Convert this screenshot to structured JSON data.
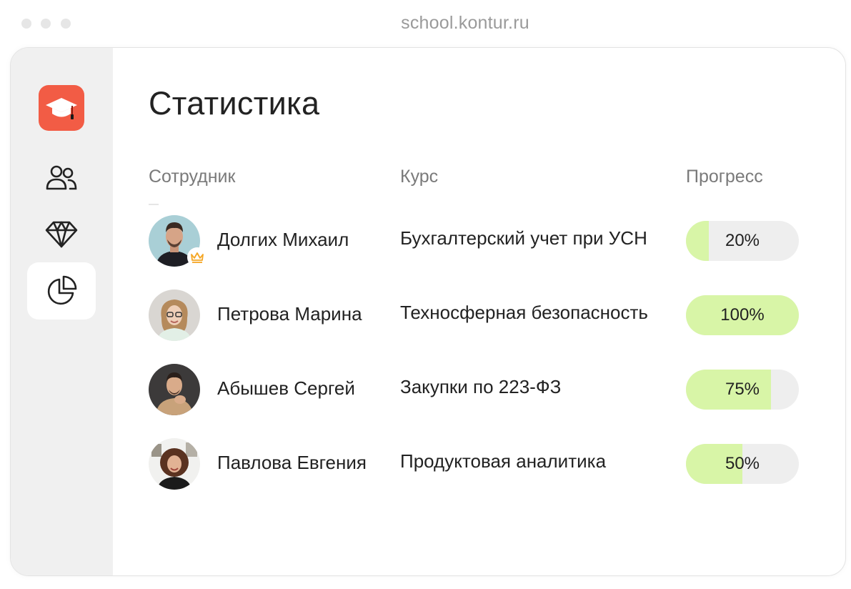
{
  "browser": {
    "url": "school.kontur.ru"
  },
  "sidebar": {
    "logo_icon": "graduation-cap-icon",
    "items": [
      {
        "icon": "users-icon",
        "active": false
      },
      {
        "icon": "diamond-icon",
        "active": false
      },
      {
        "icon": "pie-chart-icon",
        "active": true
      }
    ]
  },
  "page": {
    "title": "Статистика"
  },
  "table": {
    "headers": {
      "employee": "Сотрудник",
      "course": "Курс",
      "progress": "Прогресс"
    },
    "rows": [
      {
        "name": "Долгих Михаил",
        "course": "Бухгалтерский учет при УСН",
        "progress_label": "20%",
        "progress": 20,
        "admin_badge": "crown-icon"
      },
      {
        "name": "Петрова Марина",
        "course": "Техносферная безопасность",
        "progress_label": "100%",
        "progress": 100
      },
      {
        "name": "Абышев Сергей",
        "course": "Закупки по 223-ФЗ",
        "progress_label": "75%",
        "progress": 75
      },
      {
        "name": "Павлова Евгения",
        "course": "Продуктовая аналитика",
        "progress_label": "50%",
        "progress": 50
      }
    ]
  },
  "colors": {
    "accent": "#f25c45",
    "progress_fill": "#d8f5a7",
    "progress_track": "#eeeeee",
    "sidebar_bg": "#f0f0f0",
    "crown": "#f5a623"
  }
}
